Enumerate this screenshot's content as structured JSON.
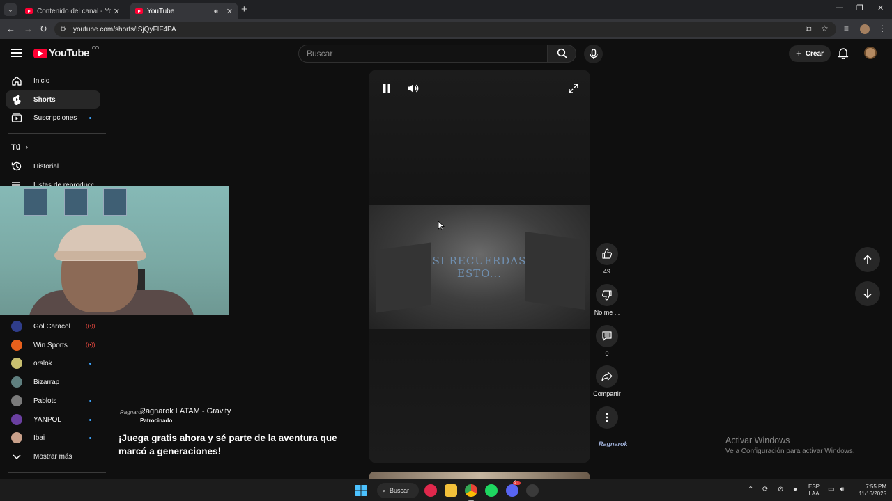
{
  "browser": {
    "tabs": [
      {
        "label": "Contenido del canal - YouTube",
        "active": false
      },
      {
        "label": "YouTube",
        "active": true
      }
    ],
    "url": "youtube.com/shorts/ISjQyFIF4PA"
  },
  "header": {
    "logo_text": "YouTube",
    "country_code": "CO",
    "search_placeholder": "Buscar",
    "create_label": "Crear"
  },
  "sidebar": {
    "main": [
      {
        "label": "Inicio",
        "icon": "home-icon"
      },
      {
        "label": "Shorts",
        "icon": "shorts-icon",
        "active": true
      },
      {
        "label": "Suscripciones",
        "icon": "subscriptions-icon"
      }
    ],
    "you_heading": "Tú",
    "you_items": [
      {
        "label": "Historial",
        "icon": "history-icon"
      },
      {
        "label": "Listas de reproducc",
        "icon": "playlist-icon"
      }
    ],
    "subscriptions": [
      {
        "label": "Gol Caracol",
        "indicator": "live",
        "color": "#2f3d8a"
      },
      {
        "label": "Win Sports",
        "indicator": "live",
        "color": "#e8601c"
      },
      {
        "label": "orslok",
        "indicator": "dot",
        "color": "#c9c070"
      },
      {
        "label": "Bizarrap",
        "indicator": "none",
        "color": "#5f7f7f"
      },
      {
        "label": "Pablots",
        "indicator": "dot",
        "color": "#7a7a7a"
      },
      {
        "label": "YANPOL",
        "indicator": "dot",
        "color": "#6a3fa0"
      },
      {
        "label": "Ibai",
        "indicator": "dot",
        "color": "#c9a08a"
      }
    ],
    "show_more": "Mostrar más"
  },
  "video": {
    "caption_line1": "SI RECUERDAS",
    "caption_line2": "ESTO..."
  },
  "ad": {
    "channel": "Ragnarok LATAM - Gravity",
    "sponsored": "Patrocinado",
    "title": "¡Juega gratis ahora y sé parte de la aventura que marcó a generaciones!",
    "logo_text": "Ragnarok"
  },
  "actions": {
    "likes": "49",
    "dislike_label": "No me ...",
    "comments": "0",
    "share_label": "Compartir"
  },
  "watermark": {
    "line1": "Activar Windows",
    "line2": "Ve a Configuración para activar Windows."
  },
  "taskbar": {
    "search_label": "Buscar",
    "lang1": "ESP",
    "lang2": "LAA",
    "time": "7:55 PM",
    "date": "11/16/2025",
    "discord_badge": "9+"
  }
}
